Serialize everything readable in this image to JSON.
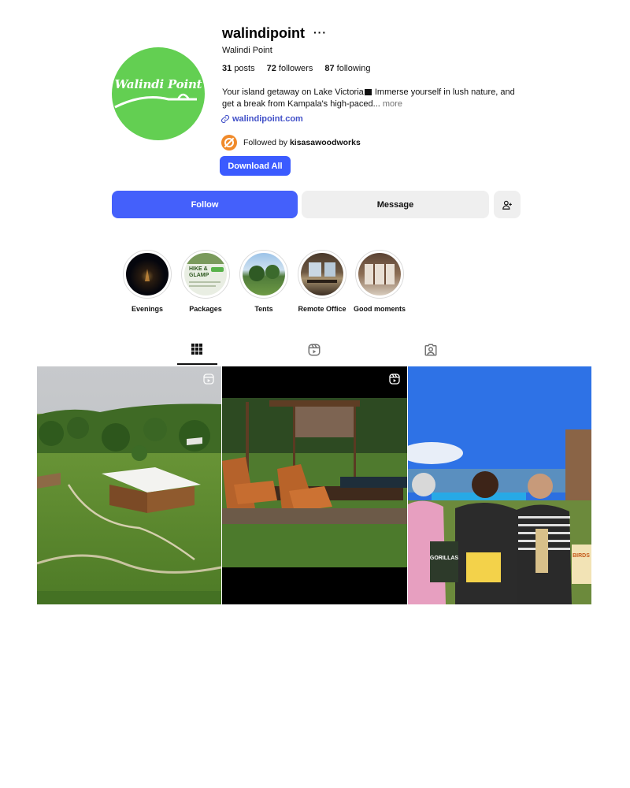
{
  "profile": {
    "username": "walindipoint",
    "more_icon": "more-dots-icon",
    "full_name": "Walindi Point",
    "avatar_text": "Walindi Point",
    "stats": {
      "posts_count": "31",
      "posts_label": "posts",
      "followers_count": "72",
      "followers_label": "followers",
      "following_count": "87",
      "following_label": "following"
    },
    "bio_part1": "Your island getaway on Lake Victoria",
    "bio_part2": " Immerse yourself in lush nature, and get a break from Kampala's high-paced...",
    "bio_more": " more",
    "website": "walindipoint.com",
    "followed_by_prefix": "Followed by",
    "followed_by_user": "kisasawoodworks"
  },
  "buttons": {
    "download_all": "Download All",
    "follow": "Follow",
    "message": "Message"
  },
  "highlights": [
    {
      "label": "Evenings"
    },
    {
      "label": "Packages",
      "cover_text_1": "HIKE &",
      "cover_text_2": "GLAMP"
    },
    {
      "label": "Tents"
    },
    {
      "label": "Remote Office"
    },
    {
      "label": "Good moments"
    }
  ],
  "tabs": [
    {
      "name": "posts",
      "icon": "grid-icon",
      "active": true
    },
    {
      "name": "reels",
      "icon": "reels-icon",
      "active": false
    },
    {
      "name": "tagged",
      "icon": "tagged-icon",
      "active": false
    }
  ],
  "posts": [
    {
      "type": "reel",
      "icon": "reel-badge-icon"
    },
    {
      "type": "reel",
      "icon": "reel-badge-icon"
    },
    {
      "type": "photo",
      "book_1": "GORILLAS",
      "book_2": "BIRDS"
    }
  ],
  "colors": {
    "accent": "#4460fb",
    "download_button": "#3b5bff",
    "avatar_bg": "#63cf52",
    "link": "#4150c8",
    "secondary_button": "#efefef"
  }
}
